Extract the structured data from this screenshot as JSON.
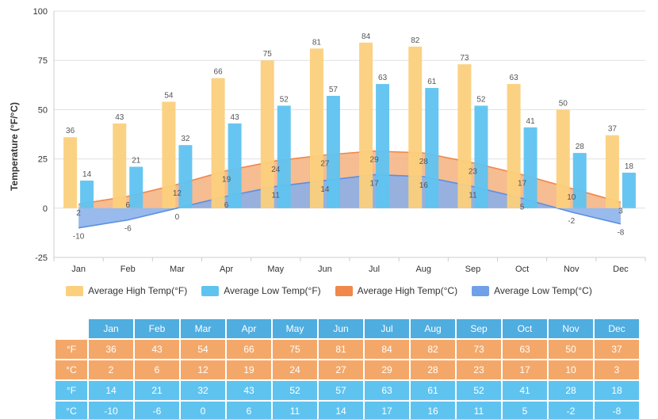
{
  "chart_data": {
    "type": "bar",
    "title": "",
    "xlabel": "",
    "ylabel": "Temperature (°F/°C)",
    "ylim": [
      -25,
      100
    ],
    "yticks": [
      -25,
      0,
      25,
      50,
      75,
      100
    ],
    "grid": true,
    "legend_position": "bottom",
    "categories": [
      "Jan",
      "Feb",
      "Mar",
      "Apr",
      "May",
      "Jun",
      "Jul",
      "Aug",
      "Sep",
      "Oct",
      "Nov",
      "Dec"
    ],
    "series": [
      {
        "name": "Average High Temp(°F)",
        "type": "bar",
        "color": "#FBD07C",
        "values": [
          36,
          43,
          54,
          66,
          75,
          81,
          84,
          82,
          73,
          63,
          50,
          37
        ]
      },
      {
        "name": "Average Low Temp(°F)",
        "type": "bar",
        "color": "#5FC3F0",
        "values": [
          14,
          21,
          32,
          43,
          52,
          57,
          63,
          61,
          52,
          41,
          28,
          18
        ]
      },
      {
        "name": "Average High Temp(°C)",
        "type": "area",
        "color": "#F0874B",
        "fill": "#F5B07F",
        "values": [
          2,
          6,
          12,
          19,
          24,
          27,
          29,
          28,
          23,
          17,
          10,
          3
        ]
      },
      {
        "name": "Average Low Temp(°C)",
        "type": "area",
        "color": "#5B8FE0",
        "fill": "#86AEEA",
        "values": [
          -10,
          -6,
          0,
          6,
          11,
          14,
          17,
          16,
          11,
          5,
          -2,
          -8
        ]
      }
    ]
  },
  "legend": {
    "items": [
      {
        "label": "Average High Temp(°F)",
        "color": "#FBD07C"
      },
      {
        "label": "Average Low Temp(°F)",
        "color": "#5FC3F0"
      },
      {
        "label": "Average High Temp(°C)",
        "color": "#F0874B"
      },
      {
        "label": "Average Low Temp(°C)",
        "color": "#6FA0E8"
      }
    ]
  },
  "table": {
    "header": [
      "",
      "Jan",
      "Feb",
      "Mar",
      "Apr",
      "May",
      "Jun",
      "Jul",
      "Aug",
      "Sep",
      "Oct",
      "Nov",
      "Dec"
    ],
    "rows": [
      {
        "unit": "°F",
        "style": "cell-orange",
        "values": [
          "36",
          "43",
          "54",
          "66",
          "75",
          "81",
          "84",
          "82",
          "73",
          "63",
          "50",
          "37"
        ]
      },
      {
        "unit": "°C",
        "style": "cell-orange",
        "values": [
          "2",
          "6",
          "12",
          "19",
          "24",
          "27",
          "29",
          "28",
          "23",
          "17",
          "10",
          "3"
        ]
      },
      {
        "unit": "°F",
        "style": "cell-blue",
        "values": [
          "14",
          "21",
          "32",
          "43",
          "52",
          "57",
          "63",
          "61",
          "52",
          "41",
          "28",
          "18"
        ]
      },
      {
        "unit": "°C",
        "style": "cell-blue",
        "values": [
          "-10",
          "-6",
          "0",
          "6",
          "11",
          "14",
          "17",
          "16",
          "11",
          "5",
          "-2",
          "-8"
        ]
      }
    ]
  }
}
